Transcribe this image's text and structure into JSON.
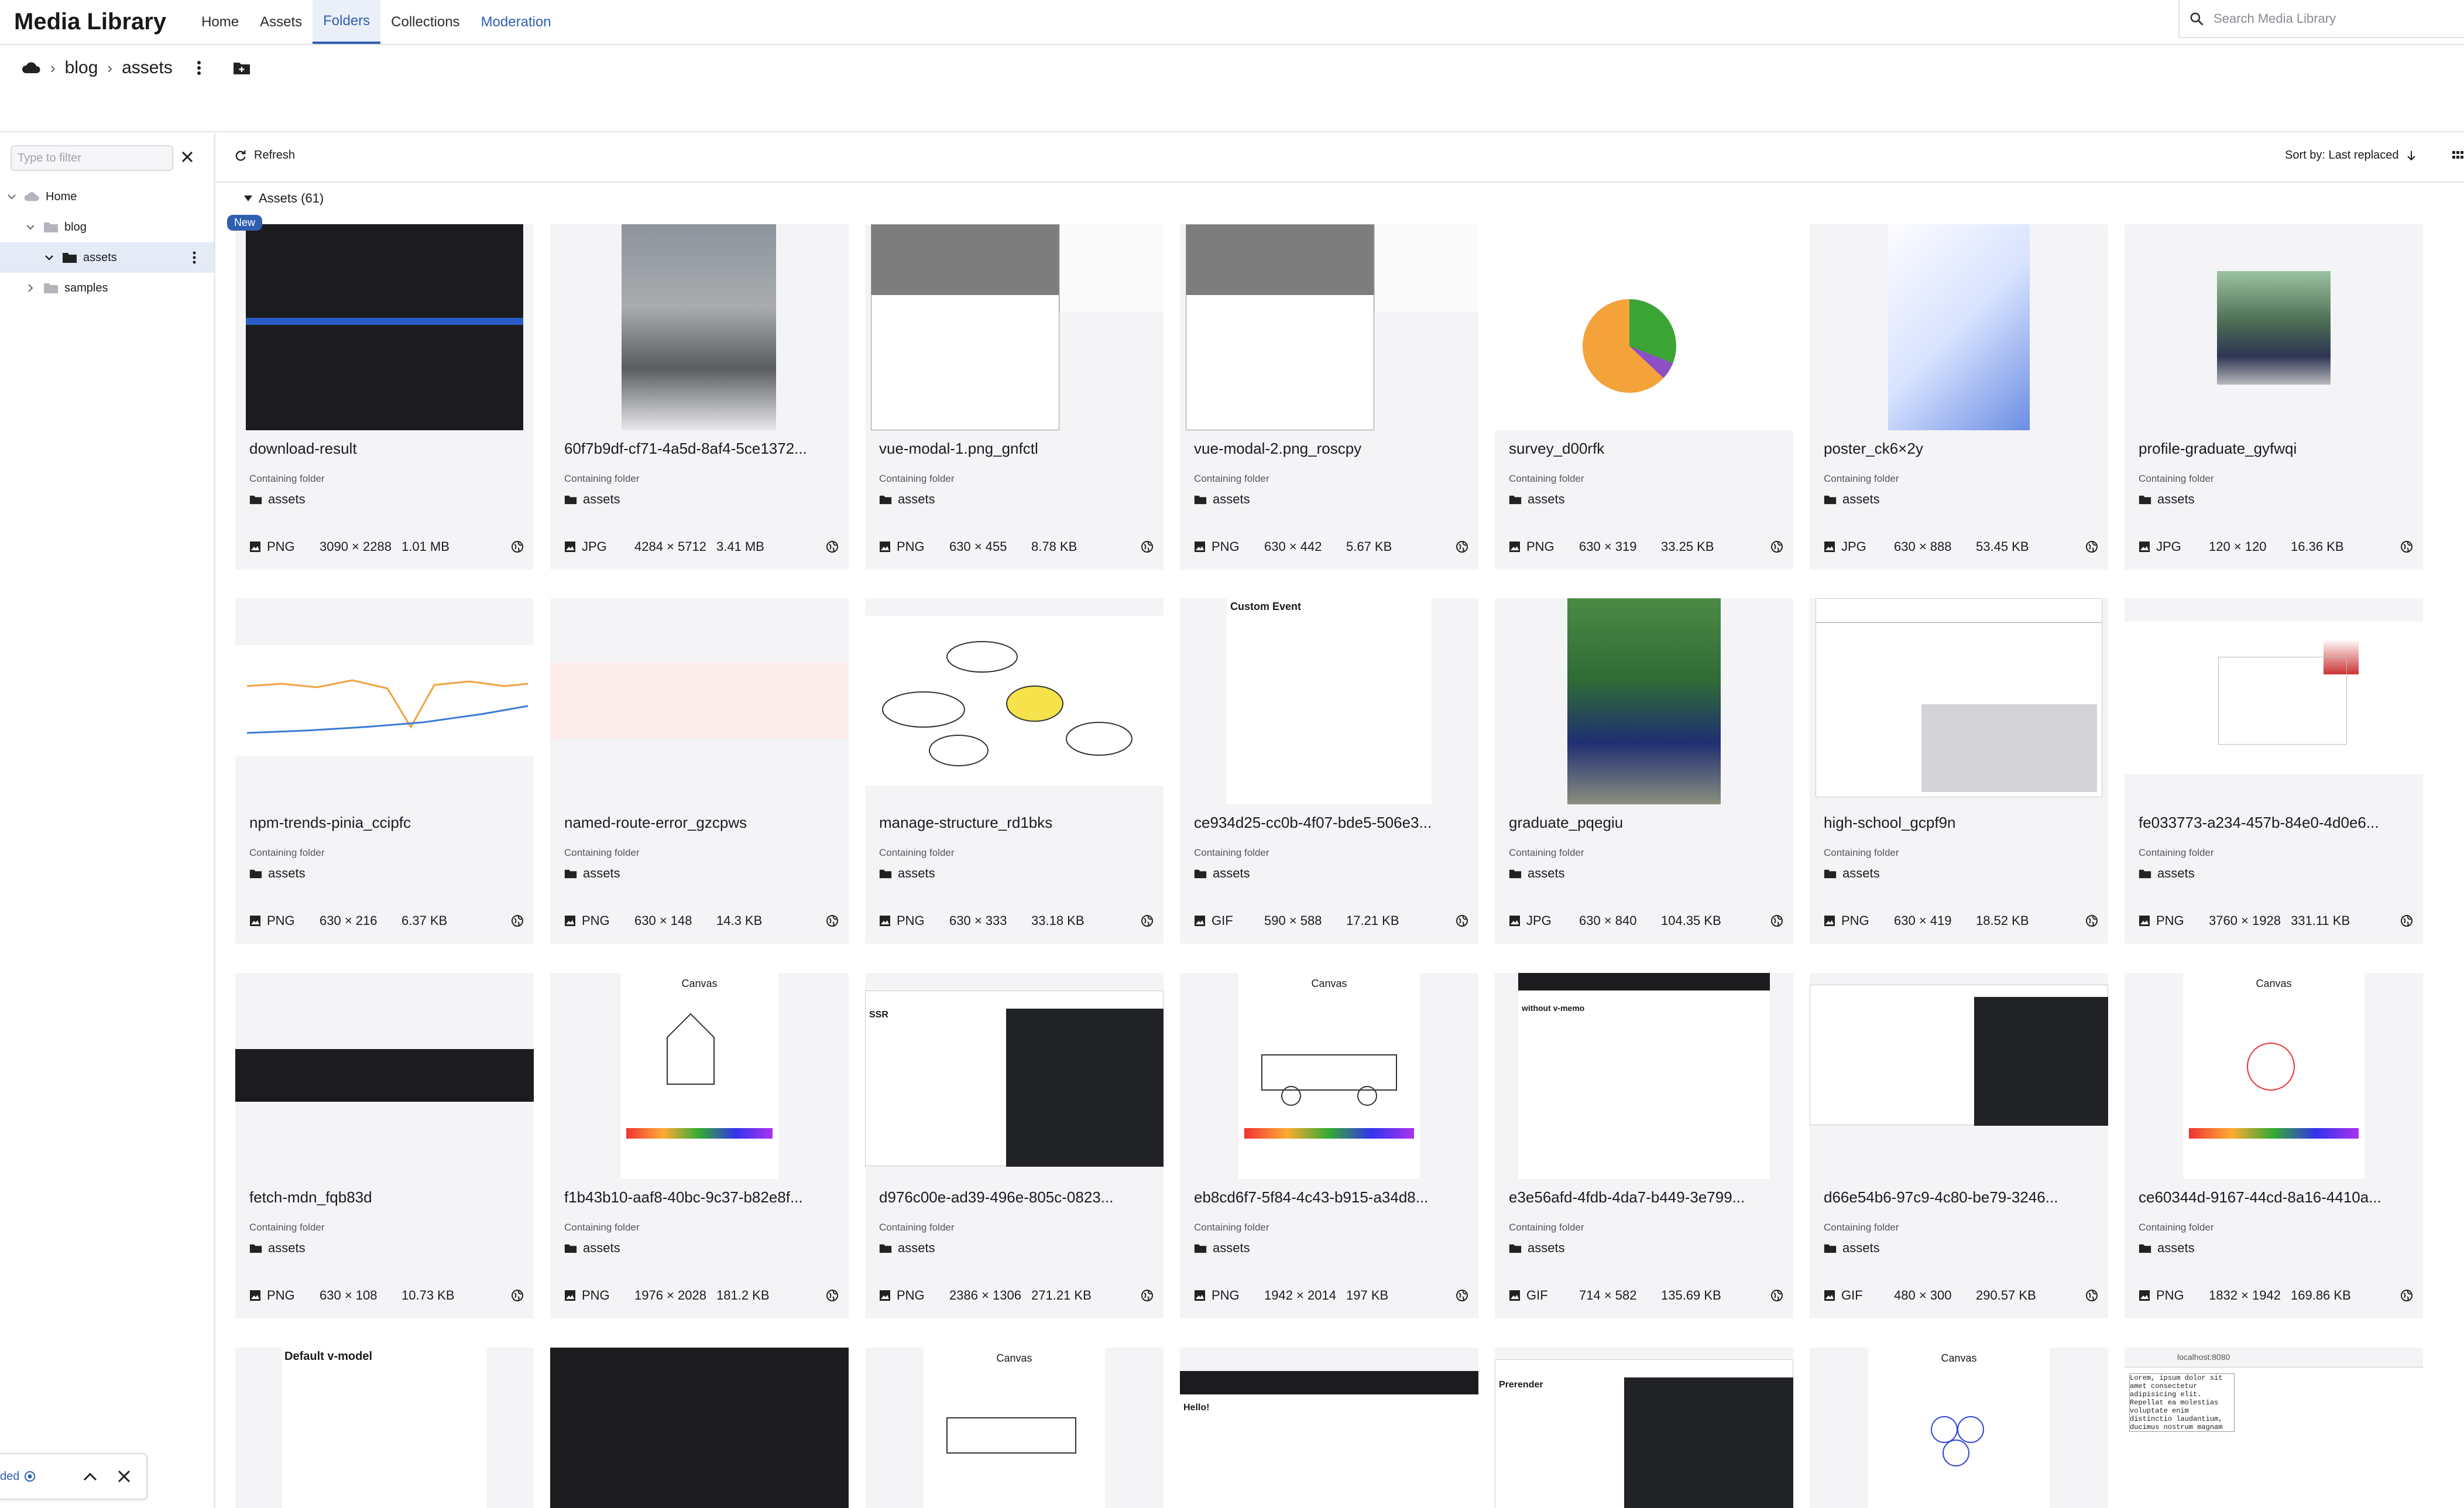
{
  "app": {
    "title": "Media Library"
  },
  "nav": [
    {
      "label": "Home"
    },
    {
      "label": "Assets"
    },
    {
      "label": "Folders"
    },
    {
      "label": "Collections"
    },
    {
      "label": "Moderation"
    }
  ],
  "search": {
    "placeholder": "Search Media Library"
  },
  "breadcrumb": {
    "items": [
      "blog",
      "assets"
    ]
  },
  "sidebar": {
    "filter_placeholder": "Type to filter",
    "tree": [
      {
        "label": "Home"
      },
      {
        "label": "blog"
      },
      {
        "label": "assets"
      },
      {
        "label": "samples"
      }
    ]
  },
  "toolbar": {
    "refresh_label": "Refresh",
    "sort_label": "Sort by: Last replaced"
  },
  "group": {
    "label": "Assets (61)"
  },
  "cards": {
    "containing_label": "Containing folder",
    "new_badge": "New",
    "items": [
      {
        "name": "download-result",
        "folder": "assets",
        "format": "PNG",
        "dims": "3090 × 2288",
        "size": "1.01 MB"
      },
      {
        "name": "60f7b9df-cf71-4a5d-8af4-5ce1372...",
        "folder": "assets",
        "format": "JPG",
        "dims": "4284 × 5712",
        "size": "3.41 MB"
      },
      {
        "name": "vue-modal-1.png_gnfctl",
        "folder": "assets",
        "format": "PNG",
        "dims": "630 × 455",
        "size": "8.78 KB"
      },
      {
        "name": "vue-modal-2.png_roscpy",
        "folder": "assets",
        "format": "PNG",
        "dims": "630 × 442",
        "size": "5.67 KB"
      },
      {
        "name": "survey_d00rfk",
        "folder": "assets",
        "format": "PNG",
        "dims": "630 × 319",
        "size": "33.25 KB"
      },
      {
        "name": "poster_ck6×2y",
        "folder": "assets",
        "format": "JPG",
        "dims": "630 × 888",
        "size": "53.45 KB"
      },
      {
        "name": "profile-graduate_gyfwqi",
        "folder": "assets",
        "format": "JPG",
        "dims": "120 × 120",
        "size": "16.36 KB"
      },
      {
        "name": "npm-trends-pinia_ccipfc",
        "folder": "assets",
        "format": "PNG",
        "dims": "630 × 216",
        "size": "6.37 KB"
      },
      {
        "name": "named-route-error_gzcpws",
        "folder": "assets",
        "format": "PNG",
        "dims": "630 × 148",
        "size": "14.3 KB"
      },
      {
        "name": "manage-structure_rd1bks",
        "folder": "assets",
        "format": "PNG",
        "dims": "630 × 333",
        "size": "33.18 KB"
      },
      {
        "name": "ce934d25-cc0b-4f07-bde5-506e3...",
        "folder": "assets",
        "format": "GIF",
        "dims": "590 × 588",
        "size": "17.21 KB"
      },
      {
        "name": "graduate_pqegiu",
        "folder": "assets",
        "format": "JPG",
        "dims": "630 × 840",
        "size": "104.35 KB"
      },
      {
        "name": "high-school_gcpf9n",
        "folder": "assets",
        "format": "PNG",
        "dims": "630 × 419",
        "size": "18.52 KB"
      },
      {
        "name": "fe033773-a234-457b-84e0-4d0e6...",
        "folder": "assets",
        "format": "PNG",
        "dims": "3760 × 1928",
        "size": "331.11 KB"
      },
      {
        "name": "fetch-mdn_fqb83d",
        "folder": "assets",
        "format": "PNG",
        "dims": "630 × 108",
        "size": "10.73 KB"
      },
      {
        "name": "f1b43b10-aaf8-40bc-9c37-b82e8f...",
        "folder": "assets",
        "format": "PNG",
        "dims": "1976 × 2028",
        "size": "181.2 KB"
      },
      {
        "name": "d976c00e-ad39-496e-805c-0823...",
        "folder": "assets",
        "format": "PNG",
        "dims": "2386 × 1306",
        "size": "271.21 KB"
      },
      {
        "name": "eb8cd6f7-5f84-4c43-b915-a34d8...",
        "folder": "assets",
        "format": "PNG",
        "dims": "1942 × 2014",
        "size": "197 KB"
      },
      {
        "name": "e3e56afd-4fdb-4da7-b449-3e799...",
        "folder": "assets",
        "format": "GIF",
        "dims": "714 × 582",
        "size": "135.69 KB"
      },
      {
        "name": "d66e54b6-97c9-4c80-be79-3246...",
        "folder": "assets",
        "format": "GIF",
        "dims": "480 × 300",
        "size": "290.57 KB"
      },
      {
        "name": "ce60344d-9167-44cd-8a16-4410a...",
        "folder": "assets",
        "format": "PNG",
        "dims": "1832 × 1942",
        "size": "169.86 KB"
      }
    ]
  },
  "thumb_text": {
    "custom_event": "Custom Event",
    "canvas": "Canvas",
    "default_vmodel": "Default v-model",
    "hello": "Hello!",
    "without_vmemo": "without v-memo",
    "prerender": "Prerender",
    "ssr": "SSR",
    "localhost": "localhost:8080",
    "lorem": "Lorem, ipsum dolor sit amet consectetur adipisicing elit. Repellat ea molestias voluptate enim distinctio laudantium, ducimus nostrum magnam et dignissimos vitae"
  },
  "toast": {
    "text": "ded"
  },
  "colors": {
    "accent": "#2f5fb0",
    "active_bg": "#eaeff8",
    "border": "#e3e3e6"
  }
}
